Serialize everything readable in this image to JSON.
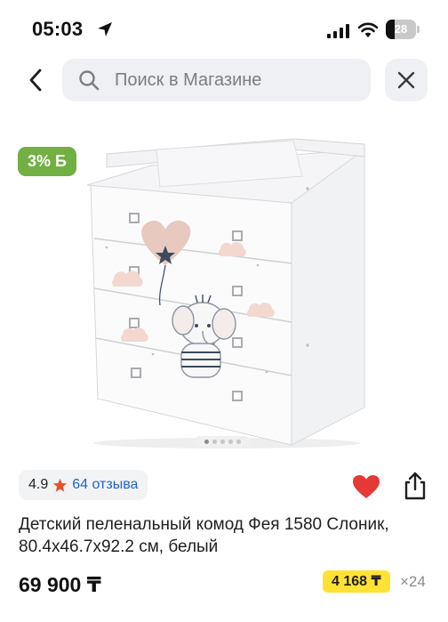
{
  "status_bar": {
    "time": "05:03",
    "battery": "28"
  },
  "search": {
    "placeholder": "Поиск в Магазине"
  },
  "product": {
    "discount_badge": "3% Б",
    "rating": "4.9",
    "reviews": "64 отзыва",
    "title": "Детский пеленальный комод Фея 1580 Слоник, 80.4x46.7x92.2 см, белый",
    "price": "69 900 ₸",
    "installment_price": "4 168 ₸",
    "installment_months": "×24",
    "image_count": 5,
    "active_image_index": 0
  },
  "colors": {
    "discount_badge": "#72b043",
    "link": "#1e63c6",
    "heart": "#e53935",
    "star": "#e8532a",
    "installment_badge": "#ffe234"
  },
  "icons": [
    "location-arrow-icon",
    "signal-icon",
    "wifi-icon",
    "battery-icon",
    "back-arrow-icon",
    "search-icon",
    "close-icon",
    "star-icon",
    "heart-icon",
    "share-icon"
  ]
}
